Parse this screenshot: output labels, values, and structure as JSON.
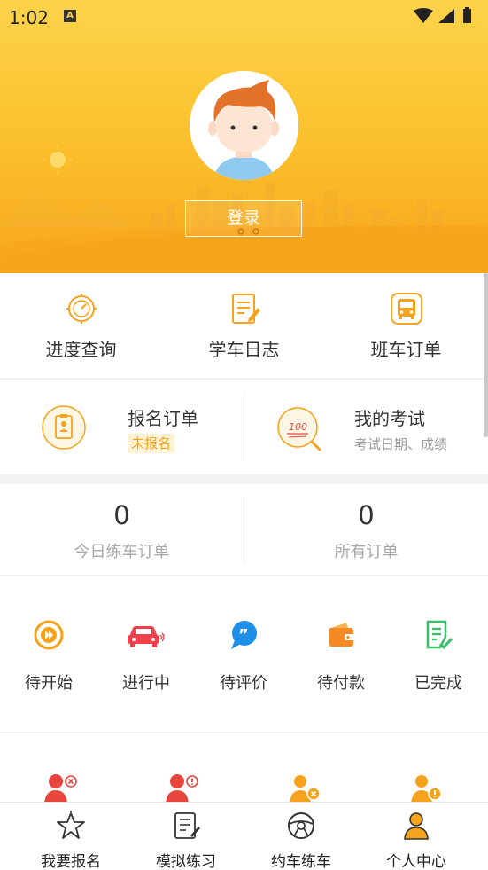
{
  "status_bar": {
    "time": "1:02",
    "indicator": "A"
  },
  "header": {
    "login_label": "登录"
  },
  "quick_actions": [
    {
      "label": "进度查询",
      "icon": "progress-icon"
    },
    {
      "label": "学车日志",
      "icon": "notebook-icon"
    },
    {
      "label": "班车订单",
      "icon": "bus-icon"
    }
  ],
  "cards": {
    "signup": {
      "title": "报名订单",
      "badge": "未报名"
    },
    "exam": {
      "title": "我的考试",
      "subtitle": "考试日期、成绩",
      "icon_text": "100"
    }
  },
  "counts": [
    {
      "value": "0",
      "label": "今日练车订单"
    },
    {
      "value": "0",
      "label": "所有订单"
    }
  ],
  "order_status": [
    {
      "label": "待开始",
      "icon": "play-icon"
    },
    {
      "label": "进行中",
      "icon": "car-icon"
    },
    {
      "label": "待评价",
      "icon": "comment-icon"
    },
    {
      "label": "待付款",
      "icon": "wallet-icon"
    },
    {
      "label": "已完成",
      "icon": "document-check-icon"
    }
  ],
  "bottom_nav": [
    {
      "label": "我要报名",
      "icon": "star-icon"
    },
    {
      "label": "模拟练习",
      "icon": "exam-paper-icon"
    },
    {
      "label": "约车练车",
      "icon": "steering-wheel-icon"
    },
    {
      "label": "个人中心",
      "icon": "person-icon"
    }
  ],
  "colors": {
    "accent": "#f6a21c",
    "header_top": "#fdd34a",
    "header_bottom": "#f8a51d",
    "red": "#f1404b"
  }
}
